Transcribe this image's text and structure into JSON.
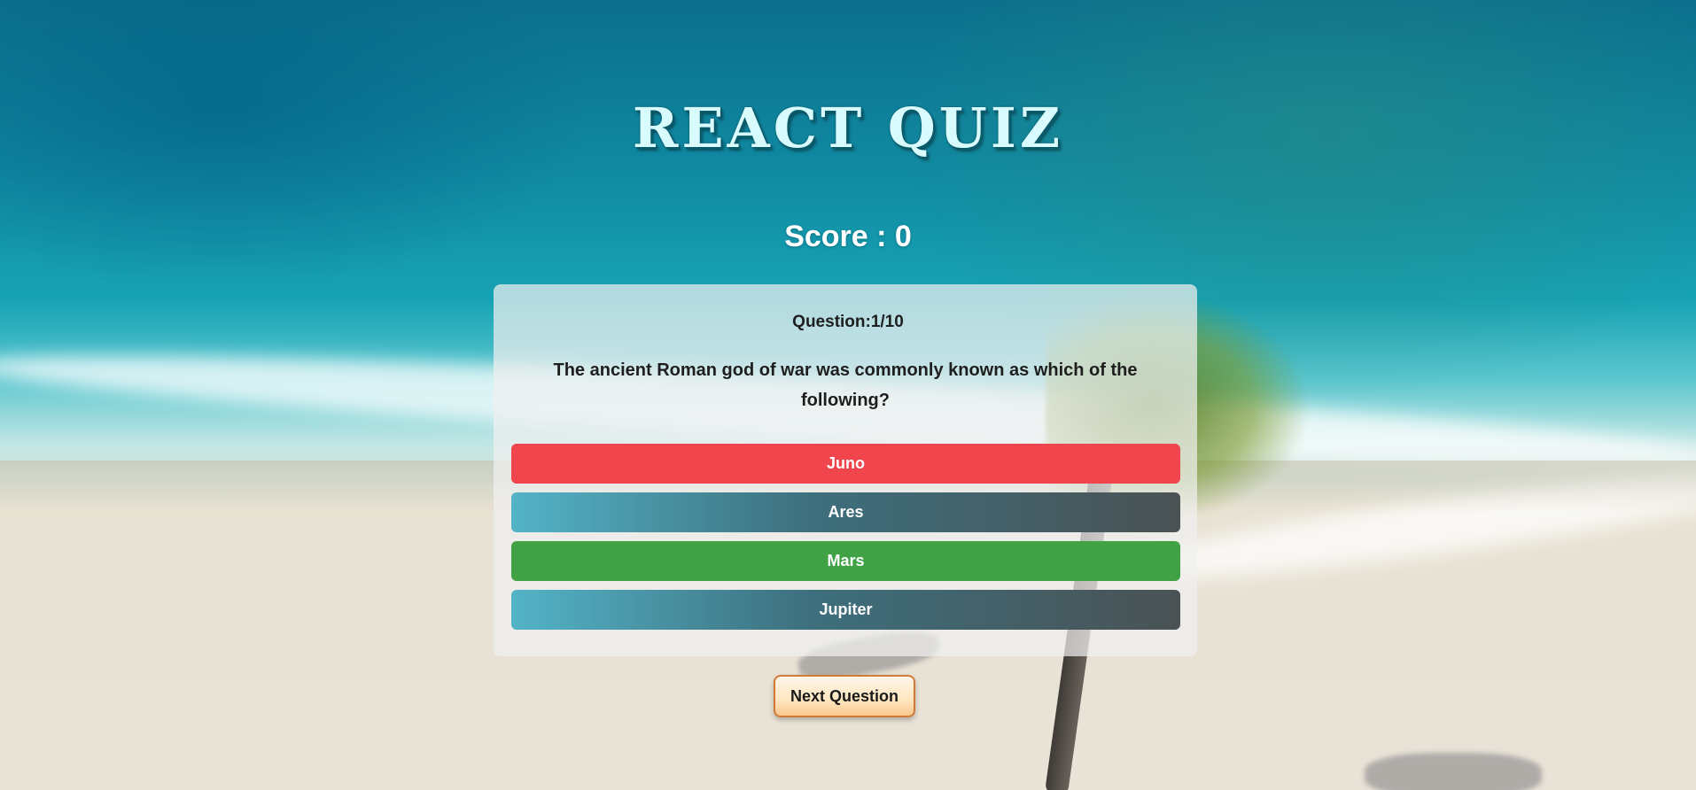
{
  "app": {
    "title": "REACT QUIZ"
  },
  "score": {
    "text": "Score : 0"
  },
  "question": {
    "number": "Question:1/10",
    "text": "The ancient Roman god of war was commonly known as which of the following?"
  },
  "answers": [
    {
      "label": "Juno",
      "state": "wrong"
    },
    {
      "label": "Ares",
      "state": "neutral"
    },
    {
      "label": "Mars",
      "state": "correct"
    },
    {
      "label": "Jupiter",
      "state": "neutral"
    }
  ],
  "next_button": {
    "label": "Next Question"
  },
  "colors": {
    "wrong": "#f0454c",
    "correct": "#40a245",
    "neutral_start": "#53b3c7",
    "neutral_end": "#4a5254",
    "card": "#f0f0f0"
  }
}
